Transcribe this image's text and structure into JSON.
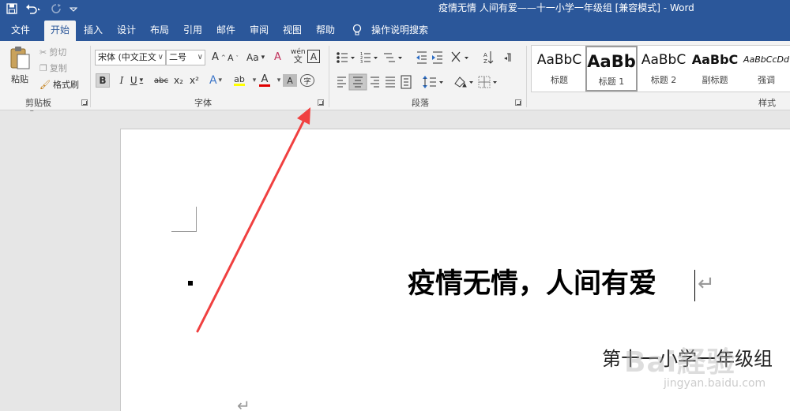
{
  "window": {
    "title": "疫情无情 人间有爱——十一小学一年级组 [兼容模式]  -  Word"
  },
  "quick_access": {
    "icons": [
      "save-icon",
      "undo-icon",
      "redo-icon",
      "customize-icon"
    ]
  },
  "tabs": [
    "文件",
    "开始",
    "插入",
    "设计",
    "布局",
    "引用",
    "邮件",
    "审阅",
    "视图",
    "帮助",
    "操作说明搜索"
  ],
  "active_tab": "开始",
  "ribbon": {
    "clipboard": {
      "label": "剪贴板",
      "paste": "粘贴",
      "cut": "剪切",
      "copy": "复制",
      "format_painter": "格式刷"
    },
    "font": {
      "label": "字体",
      "font_name": "宋体 (中文正文",
      "font_size": "二号",
      "bold": "B",
      "italic": "I",
      "underline": "U",
      "strike": "abc",
      "subscript": "x₂",
      "superscript": "x²",
      "change_case": "Aa",
      "clear_format": "A",
      "pinyin": "wén",
      "char_border": "A",
      "text_effect": "A",
      "font_color": "A",
      "char_shading": "A",
      "enclose": "字",
      "grow": "A",
      "shrink": "A"
    },
    "paragraph": {
      "label": "段落"
    },
    "styles": {
      "label": "样式",
      "items": [
        {
          "sample": "AaBbC",
          "name": "标题"
        },
        {
          "sample": "AaBb",
          "name": "标题 1"
        },
        {
          "sample": "AaBbC",
          "name": "标题 2"
        },
        {
          "sample": "AaBbC",
          "name": "副标题"
        },
        {
          "sample": "AaBbCcDd",
          "name": "强调"
        }
      ]
    }
  },
  "document": {
    "heading": "疫情无情，人间有爱",
    "subline": "第十一小学一年级组",
    "para_mark": "↵",
    "watermark": "Bai経验",
    "watermark_url": "jingyan.baidu.com"
  },
  "colors": {
    "brand": "#2b579a",
    "ribbon_bg": "#f3f3f3",
    "arrow": "#f04040",
    "highlight_yellow": "#ffff00",
    "font_color_red": "#e00000"
  }
}
